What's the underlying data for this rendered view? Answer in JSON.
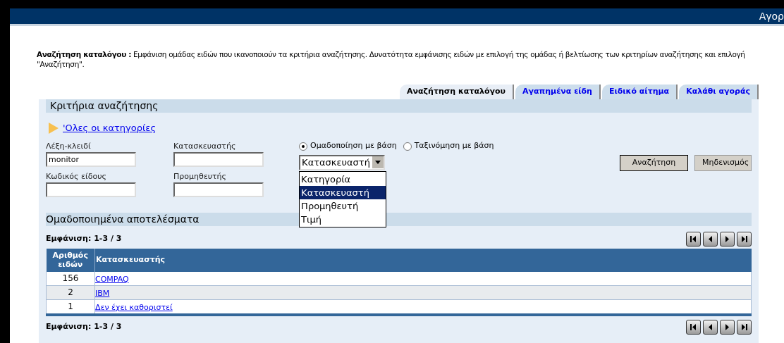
{
  "header": {
    "title": "Αγορ"
  },
  "intro": {
    "text": "**Αναζήτηση καταλόγου :** Εμφάνιση ομάδας ειδών που ικανοποιούν τα κριτήρια αναζήτησης. Δυνατότητα εμφάνισης ειδών με επιλογή της ομάδας ή βελτίωσης των κριτηρίων αναζήτησης και επιλογή \"Αναζήτηση\"."
  },
  "tabs": [
    {
      "label": "Αναζήτηση καταλόγου",
      "selected": true
    },
    {
      "label": "Αγαπημένα είδη",
      "selected": false
    },
    {
      "label": "Ειδικό αίτημα",
      "selected": false
    },
    {
      "label": "Καλάθι αγοράς",
      "selected": false
    }
  ],
  "criteria": {
    "title": "Κριτήρια αναζήτησης",
    "category_link": "'Ολες οι κατηγορίες",
    "fields": [
      {
        "label": "Λέξη-κλειδί",
        "value": "monitor"
      },
      {
        "label": "Κατασκευαστής"
      },
      {
        "label": "Κωδικός είδους"
      },
      {
        "label": "Προμηθευτής"
      }
    ],
    "radios": [
      {
        "label": "Ομαδοποίηση με βάση",
        "selected": true
      },
      {
        "label": "Ταξινόμηση με βάση",
        "selected": false
      }
    ],
    "dropdown": {
      "value": "Κατασκευαστή",
      "expanded": true,
      "options": [
        {
          "label": "Κατηγορία",
          "selected": false
        },
        {
          "label": "Κατασκευαστή",
          "selected": true
        },
        {
          "label": "Προμηθευτή",
          "selected": false
        },
        {
          "label": "Τιμή",
          "selected": false
        }
      ]
    },
    "buttons": [
      "Αναζήτηση",
      "Μηδενισμός"
    ]
  },
  "results": {
    "title": "Ομαδοποιημένα αποτελέσματα",
    "range_top": "Εμφάνιση: 1-3 / 3",
    "range_bottom": "Εμφάνιση: 1-3 / 3",
    "columns": [
      "Αριθμός ειδών",
      "Κατασκευαστής"
    ],
    "rows": [
      {
        "count": "156",
        "name": "COMPAQ"
      },
      {
        "count": "2",
        "name": "IBM"
      },
      {
        "count": "1",
        "name": "Δεν έχει καθοριστεί"
      }
    ]
  }
}
